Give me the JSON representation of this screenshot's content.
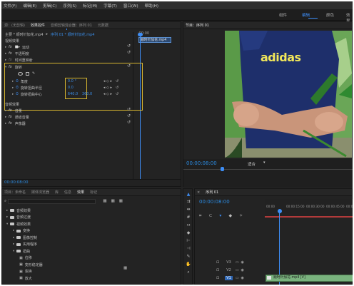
{
  "menu": [
    "文件(F)",
    "编辑(E)",
    "剪辑(C)",
    "序列(S)",
    "标记(M)",
    "字幕(T)",
    "窗口(W)",
    "帮助(H)"
  ],
  "workspaces": {
    "items": [
      "组件",
      "编辑",
      "颜色",
      "效果"
    ],
    "active": "编辑"
  },
  "source_panel": {
    "tabs": [
      "源：(无剪辑)",
      "效果控件",
      "音频剪辑混合器：序列 01",
      "元数据"
    ],
    "active_tab": "效果控件",
    "clip_header": "主要 * 顺时针加花.mp4",
    "sequence_header": "序列 01 * 顺时针加花.mp4",
    "mini_timeline_time": ":00:00",
    "mini_clip_label": "顺时针加花.mp4",
    "video_effects_label": "视频效果",
    "effects": [
      {
        "label": "运动",
        "icon": "motion-icon"
      },
      {
        "label": "不透明度"
      },
      {
        "label": "时间重映射"
      },
      {
        "label": "旋转"
      }
    ],
    "rotation_props": [
      {
        "label": "角度",
        "value": "0.0 °"
      },
      {
        "label": "旋转扭曲半径",
        "value": "0.0"
      },
      {
        "label": "旋转扭曲中心",
        "value": "640.0",
        "value2": "360.0"
      }
    ],
    "audio_effects_label": "音频效果",
    "audio_effects": [
      "音量",
      "通道音量",
      "声像器"
    ],
    "timecode": "00:00:08:00"
  },
  "program_monitor": {
    "tab": "节目：序列 01",
    "timecode": "00:00:08:00",
    "fit_label": "适合",
    "shirt_text": "adidas"
  },
  "project_panel": {
    "tabs": [
      "项目：未命名",
      "媒体浏览器",
      "库",
      "信息",
      "效果",
      "标记"
    ],
    "active_tab": "效果",
    "tree": [
      {
        "label": "音频效果",
        "level": 0,
        "expanded": false
      },
      {
        "label": "音频过渡",
        "level": 0,
        "expanded": false
      },
      {
        "label": "视频效果",
        "level": 0,
        "expanded": true
      },
      {
        "label": "变换",
        "level": 1,
        "expanded": false
      },
      {
        "label": "图像控制",
        "level": 1,
        "expanded": false
      },
      {
        "label": "实用程序",
        "level": 1,
        "expanded": false
      },
      {
        "label": "扭曲",
        "level": 1,
        "expanded": true
      },
      {
        "label": "位移",
        "level": 2,
        "item": true
      },
      {
        "label": "变形稳定器",
        "level": 2,
        "item": true
      },
      {
        "label": "变换",
        "level": 2,
        "item": true
      },
      {
        "label": "放大",
        "level": 2,
        "item": true
      }
    ]
  },
  "timeline": {
    "tab": "序列 01",
    "timecode": "00:00:08:00",
    "ruler": [
      "00:00",
      "00:00:15:00",
      "00:00:30:00",
      "00:00:45:00",
      "00:00:0"
    ],
    "tracks": [
      "V3",
      "V2",
      "V1"
    ],
    "clip_label": "顺时针加花.mp4 [V]"
  }
}
